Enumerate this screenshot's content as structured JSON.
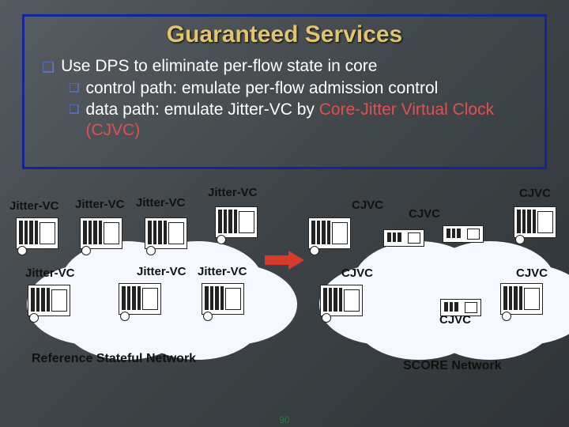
{
  "title": "Guaranteed Services",
  "bullets": {
    "l1": "Use DPS to eliminate per-flow state in core",
    "l2": "control path: emulate per-flow admission control",
    "l3_a": "data path: emulate Jitter-VC by ",
    "l3_b": "Core-Jitter Virtual Clock (CJVC)"
  },
  "labels": {
    "jvc": "Jitter-VC",
    "cjvc": "CJVC"
  },
  "captions": {
    "left": "Reference Stateful Network",
    "right": "SCORE Network"
  },
  "page": "90"
}
